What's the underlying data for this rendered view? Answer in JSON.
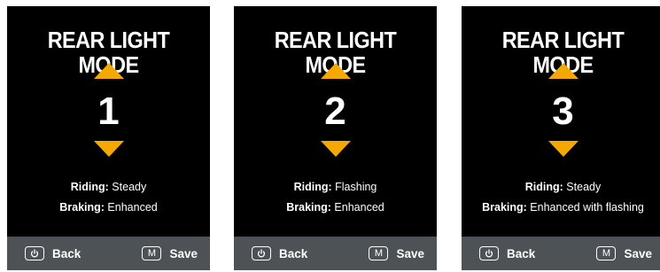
{
  "screens": [
    {
      "title": "REAR LIGHT MODE",
      "mode": "1",
      "riding_label": "Riding:",
      "riding_value": " Steady",
      "braking_label": "Braking:",
      "braking_value": " Enhanced",
      "back_label": "Back",
      "save_key": "M",
      "save_label": "Save"
    },
    {
      "title": "REAR LIGHT MODE",
      "mode": "2",
      "riding_label": "Riding:",
      "riding_value": " Flashing",
      "braking_label": "Braking:",
      "braking_value": " Enhanced",
      "back_label": "Back",
      "save_key": "M",
      "save_label": "Save"
    },
    {
      "title": "REAR LIGHT MODE",
      "mode": "3",
      "riding_label": "Riding:",
      "riding_value": " Steady",
      "braking_label": "Braking:",
      "braking_value": " Enhanced with flashing",
      "back_label": "Back",
      "save_key": "M",
      "save_label": "Save"
    }
  ],
  "icons": {
    "back": "power-icon",
    "up": "arrow-up-icon",
    "down": "arrow-down-icon"
  },
  "colors": {
    "screen_background": "#000000",
    "accent": "#f5a800",
    "footer": "#4d5257",
    "text": "#ffffff"
  }
}
